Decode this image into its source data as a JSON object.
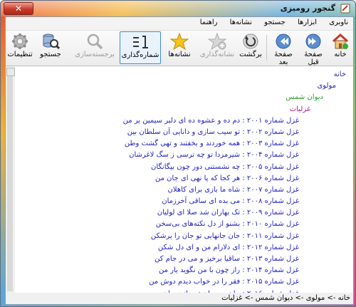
{
  "window": {
    "title": "گنجور رومیزی"
  },
  "menu": [
    "ناوبری",
    "ابزارها",
    "جستجو",
    "نشانه‌ها",
    "راهنما"
  ],
  "toolbar": [
    {
      "label": "خانه",
      "icon": "home-icon",
      "enabled": true
    },
    {
      "label": "صفحهٔ قبل",
      "icon": "previous-page-icon",
      "enabled": true
    },
    {
      "label": "صفحهٔ بعد",
      "icon": "next-page-icon",
      "enabled": true
    },
    {
      "label": "برگشت",
      "icon": "back-icon",
      "enabled": true
    },
    {
      "label": "نشانه‌گذاری",
      "icon": "add-bookmark-icon",
      "enabled": false
    },
    {
      "label": "نشانه‌ها",
      "icon": "bookmarks-star-icon",
      "enabled": true
    },
    {
      "label": "شماره‌گذاری",
      "icon": "numbering-icon",
      "enabled": true
    },
    {
      "label": "برجسته‌سازی",
      "icon": "highlight-icon",
      "enabled": false
    },
    {
      "label": "جستجو",
      "icon": "search-database-icon",
      "enabled": true
    },
    {
      "label": "تنظیمات",
      "icon": "settings-gear-icon",
      "enabled": true
    }
  ],
  "breadcrumbs": [
    "خانه",
    "مولوی",
    "دیوان شمس",
    "غزلیات"
  ],
  "poems": [
    {
      "label": "غزل شماره ۲۰۰۱",
      "first_line": "دم ده و عشوه ده ای دلبر سیمین بر من"
    },
    {
      "label": "غزل شماره ۲۰۰۲",
      "first_line": "تو سیب سازی و دانایی آن سلطان بین"
    },
    {
      "label": "غزل شماره ۲۰۰۳",
      "first_line": "همه خوردند و بخفتند و تهی گشت وطن"
    },
    {
      "label": "غزل شماره ۲۰۰۴",
      "first_line": "شیرمردا تو چه ترسی ز سگ لاغرشان"
    },
    {
      "label": "غزل شماره ۲۰۰۵",
      "first_line": "چه نشستنی دور چون بیگانگان"
    },
    {
      "label": "غزل شماره ۲۰۰۶",
      "first_line": "هر کجا که پا نهی ای جان من"
    },
    {
      "label": "غزل شماره ۲۰۰۷",
      "first_line": "شاه ما بازی برای کاهلان"
    },
    {
      "label": "غزل شماره ۲۰۰۸",
      "first_line": "می بده ای ساقی آخرزمان"
    },
    {
      "label": "غزل شماره ۲۰۰۹",
      "first_line": "تک بهاران شد صلا ای لولیان"
    },
    {
      "label": "غزل شماره ۲۰۱۰",
      "first_line": "بشنو از دل نکته‌های بی‌سخن"
    },
    {
      "label": "غزل شماره ۲۰۱۱",
      "first_line": "جان جانهایی تو جان را پرشکن"
    },
    {
      "label": "غزل شماره ۲۰۱۲",
      "first_line": "ای دلارام من و ای دل شکن"
    },
    {
      "label": "غزل شماره ۲۰۱۳",
      "first_line": "ساقیا برخیز و می در جام کن"
    },
    {
      "label": "غزل شماره ۲۰۱۴",
      "first_line": "راز چون با من نگوید یار من"
    },
    {
      "label": "غزل شماره ۲۰۱۵",
      "first_line": "فقر را در خواب دیدم دوش من"
    },
    {
      "label": "غزل شماره ۲۰۱۶",
      "first_line": "جان من جان تو جانت جان من"
    },
    {
      "label": "غزل شماره ۲۰۱۷",
      "first_line": "آمد آمد در میان خوب ختن"
    }
  ],
  "status": {
    "path": "خانه -> مولوی -> دیوان شمس -> غزلیات"
  }
}
